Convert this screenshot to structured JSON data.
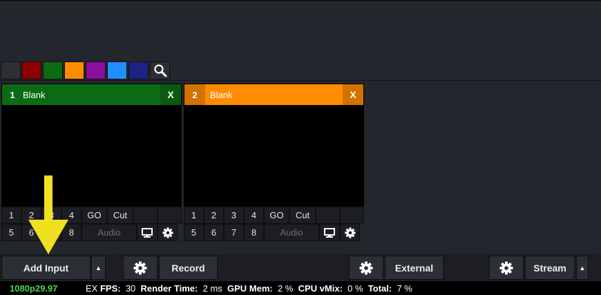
{
  "colors": {
    "background": "#23262c",
    "green_input": "#0b6b14",
    "green_input_dark": "#0a5a10",
    "orange_input": "#ff8c00",
    "orange_input_dark": "#d27200",
    "arrow": "#f0e020",
    "status_format": "#4bd84b"
  },
  "color_filters": [
    {
      "name": "none",
      "color": "#2c2f35"
    },
    {
      "name": "dark-red",
      "color": "#8b0000"
    },
    {
      "name": "green",
      "color": "#0b6b14"
    },
    {
      "name": "orange",
      "color": "#ff8c00"
    },
    {
      "name": "purple",
      "color": "#8b0f9e"
    },
    {
      "name": "blue",
      "color": "#1e90ff"
    },
    {
      "name": "navy",
      "color": "#1d2285"
    }
  ],
  "search_icon": "magnifier-icon",
  "inputs": [
    {
      "number": "1",
      "title": "Blank",
      "close": "X",
      "row1": [
        "1",
        "2",
        "3",
        "4",
        "GO",
        "Cut"
      ],
      "row2": [
        "5",
        "6",
        "7",
        "8",
        "Audio"
      ]
    },
    {
      "number": "2",
      "title": "Blank",
      "close": "X",
      "row1": [
        "1",
        "2",
        "3",
        "4",
        "GO",
        "Cut"
      ],
      "row2": [
        "5",
        "6",
        "7",
        "8",
        "Audio"
      ]
    }
  ],
  "bottom": {
    "add_input": "Add Input",
    "record": "Record",
    "external": "External",
    "stream": "Stream",
    "dropdown_glyph": "▲"
  },
  "status": {
    "format": "1080p29.97",
    "ex": "EX",
    "fps_label": "FPS:",
    "fps_value": "30",
    "render_label": "Render Time:",
    "render_value": "2 ms",
    "gpu_label": "GPU Mem:",
    "gpu_value": "2 %",
    "cpu_label": "CPU vMix:",
    "cpu_value": "0 %",
    "total_label": "Total:",
    "total_value": "7 %"
  }
}
